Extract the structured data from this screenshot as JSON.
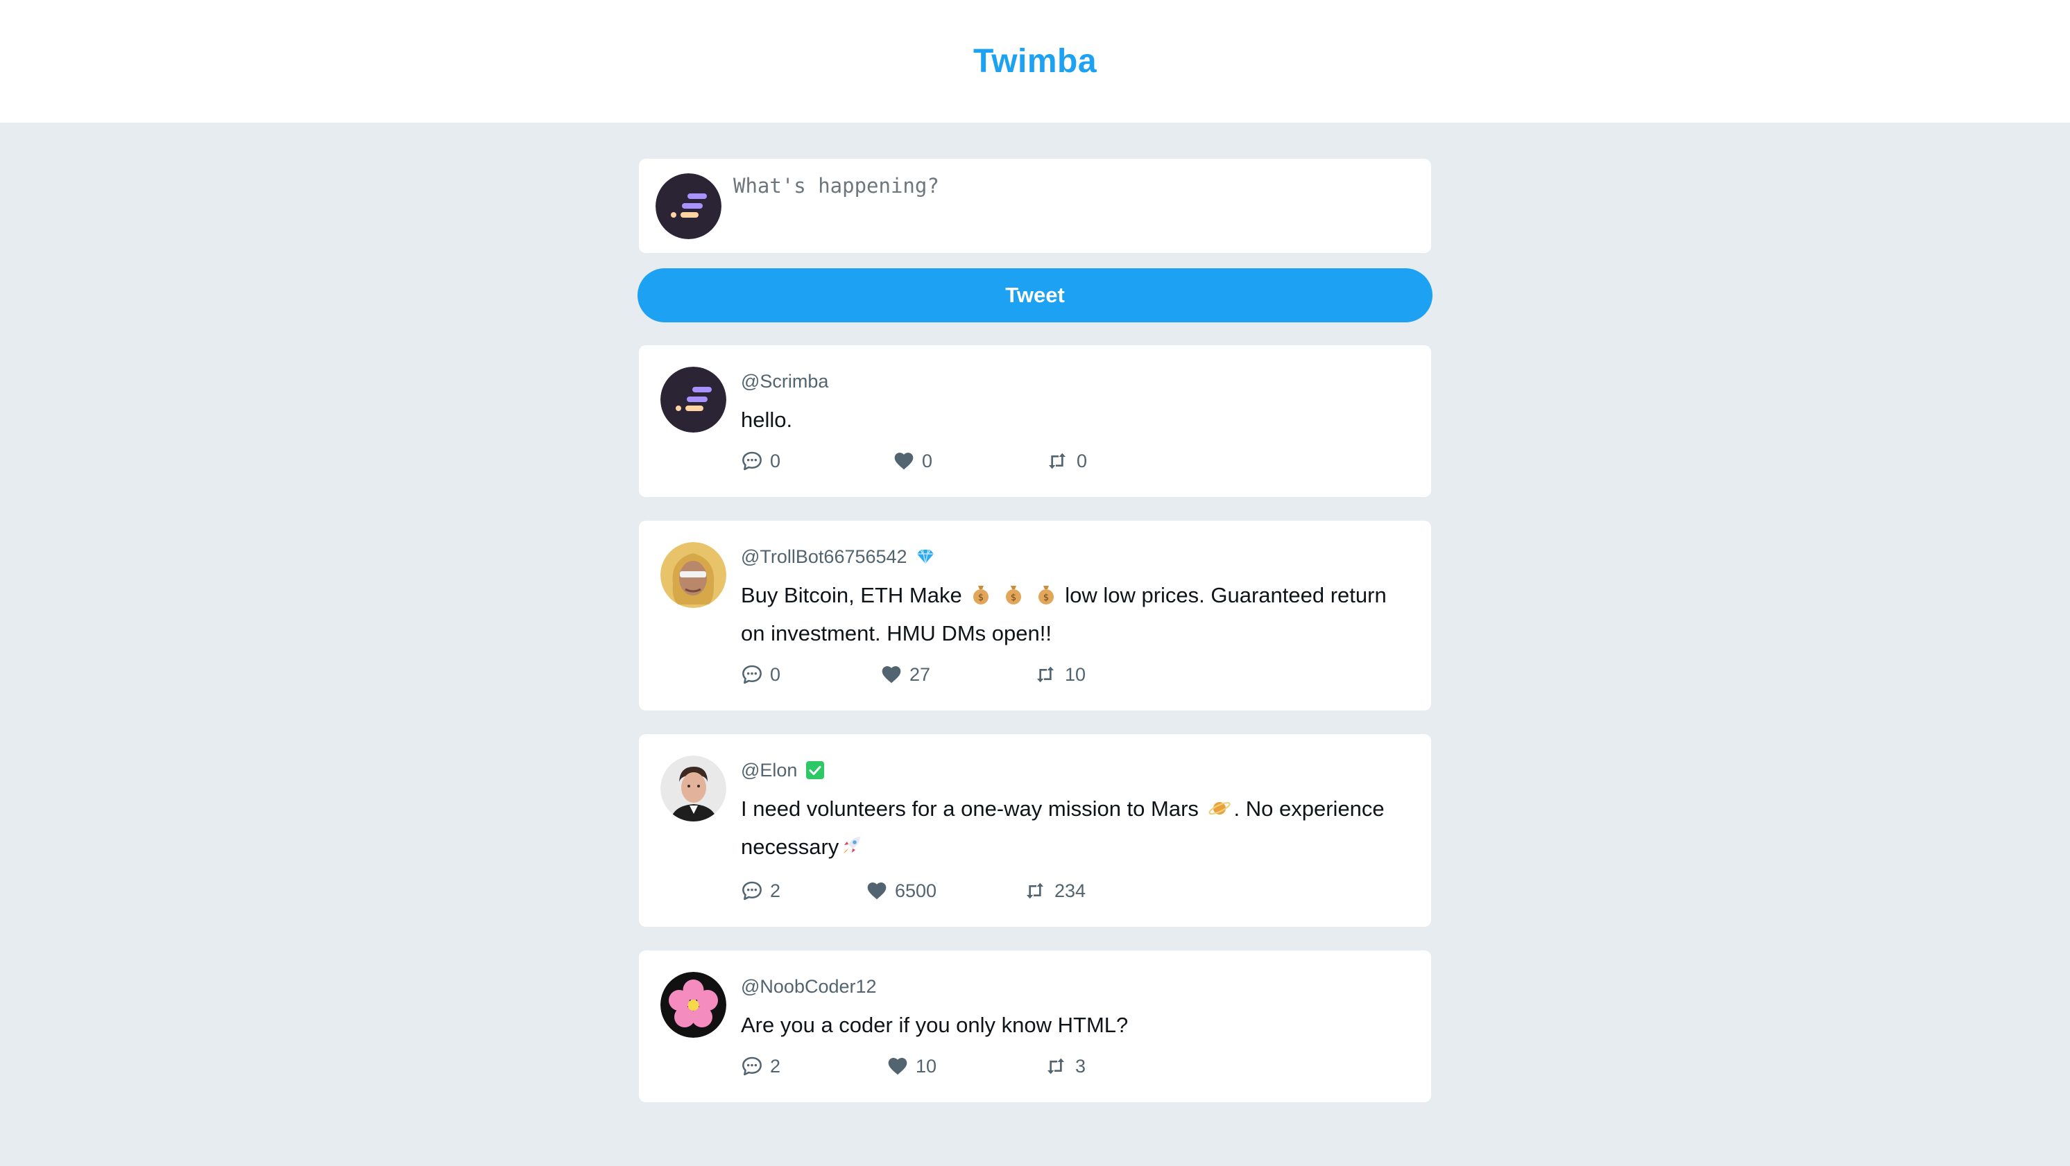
{
  "header": {
    "brand": "Twimba"
  },
  "compose": {
    "placeholder": "What's happening?",
    "button_label": "Tweet"
  },
  "tweets": [
    {
      "handle": "@Scrimba",
      "badge": null,
      "text": "hello.",
      "replies": "0",
      "likes": "0",
      "retweets": "0"
    },
    {
      "handle": "@TrollBot66756542",
      "badge": "diamond",
      "text_parts": [
        "Buy Bitcoin, ETH Make",
        "low low prices. Guaranteed return on investment. HMU DMs open!!"
      ],
      "replies": "0",
      "likes": "27",
      "retweets": "10"
    },
    {
      "handle": "@Elon",
      "badge": "check",
      "text_parts": [
        "I need volunteers for a one-way mission to Mars",
        ". No experience necessary"
      ],
      "replies": "2",
      "likes": "6500",
      "retweets": "234"
    },
    {
      "handle": "@NoobCoder12",
      "badge": null,
      "text": "Are you a coder if you only know HTML?",
      "replies": "2",
      "likes": "10",
      "retweets": "3"
    }
  ],
  "icons": {
    "reply": "comment-dots-icon",
    "like": "heart-icon",
    "retweet": "retweet-icon"
  },
  "colors": {
    "accent": "#1da1f2",
    "background": "#e6ecf0",
    "muted": "#536471"
  }
}
